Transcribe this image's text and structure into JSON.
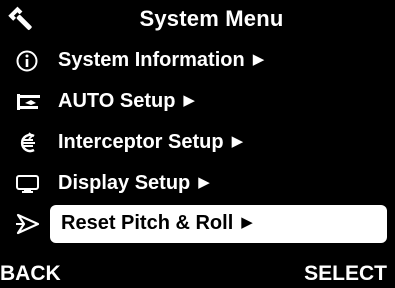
{
  "header": {
    "icon": "wrench-icon",
    "title": "System Menu"
  },
  "menu": {
    "items": [
      {
        "icon": "info-icon",
        "label": "System Information",
        "arrow": "▶",
        "selected": false
      },
      {
        "icon": "auto-icon",
        "label": "AUTO Setup",
        "arrow": "▶",
        "selected": false
      },
      {
        "icon": "interceptor-icon",
        "label": "Interceptor Setup",
        "arrow": "▶",
        "selected": false
      },
      {
        "icon": "display-icon",
        "label": "Display Setup",
        "arrow": "▶",
        "selected": false
      },
      {
        "icon": "pitch-roll-icon",
        "label": "Reset Pitch & Roll",
        "arrow": "▶",
        "selected": true
      }
    ]
  },
  "footer": {
    "back_label": "BACK",
    "select_label": "SELECT"
  },
  "colors": {
    "background": "#000000",
    "text": "#ffffff",
    "highlight": "#ffffff",
    "highlight_text": "#000000"
  }
}
